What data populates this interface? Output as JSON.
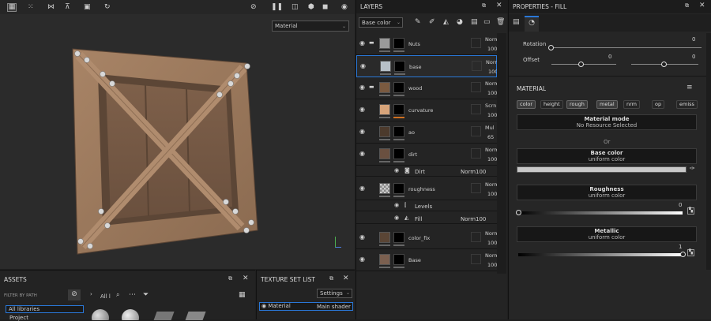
{
  "viewport": {
    "material_dropdown": "Material",
    "toolbar_icons": [
      "grid-icon",
      "dotgrid-icon",
      "split-icon",
      "align-icon",
      "media-icon",
      "history-icon",
      "visibility-off-icon",
      "pause-icon",
      "frame-icon",
      "cube-icon",
      "video-icon",
      "camera-icon"
    ]
  },
  "layers": {
    "title": "LAYERS",
    "channel": "Base color",
    "rows": [
      {
        "name": "Nuts",
        "blend": "Norm",
        "opacity": "100",
        "folder": true,
        "color": "#9a9a9a"
      },
      {
        "name": "base",
        "blend": "Norm",
        "opacity": "100",
        "folder": false,
        "color": "#b7c0c8",
        "selected": true
      },
      {
        "name": "wood",
        "blend": "Norm",
        "opacity": "100",
        "folder": true,
        "color": "#7a5a40"
      },
      {
        "name": "curvature",
        "blend": "Scrn",
        "opacity": "100",
        "folder": false,
        "color": "#d7a47a"
      },
      {
        "name": "ao",
        "blend": "Mul",
        "opacity": "65",
        "folder": false,
        "color": "#4c3a2c"
      },
      {
        "name": "dirt",
        "blend": "Norm",
        "opacity": "100",
        "folder": false,
        "color": "#6a5040"
      }
    ],
    "dirt_effect": {
      "name": "Dirt",
      "blend": "Norm",
      "opacity": "100"
    },
    "roughness": {
      "name": "roughness",
      "blend": "Norm",
      "opacity": "100"
    },
    "roughness_effects": [
      {
        "name": "Levels"
      },
      {
        "name": "Fill",
        "blend": "Norm",
        "opacity": "100"
      }
    ],
    "bottom_rows": [
      {
        "name": "color_fix",
        "blend": "Norm",
        "opacity": "100",
        "color": "#5a4535"
      },
      {
        "name": "Base",
        "blend": "Norm",
        "opacity": "100",
        "color": "#7b6050"
      }
    ]
  },
  "properties": {
    "title": "PROPERTIES - FILL",
    "rotation_label": "Rotation",
    "rotation_value": "0",
    "offset_label": "Offset",
    "offset_x": "0",
    "offset_y": "0",
    "material_title": "MATERIAL",
    "channels": [
      "color",
      "height",
      "rough",
      "metal",
      "nrm",
      "op",
      "emiss"
    ],
    "material_mode_title": "Material mode",
    "material_mode_value": "No Resource Selected",
    "or_label": "Or",
    "base_color_title": "Base color",
    "base_color_sub": "uniform color",
    "base_color_swatch": "#c8c8c8",
    "roughness_title": "Roughness",
    "roughness_sub": "uniform color",
    "roughness_value": "0",
    "roughness_level": 0.0,
    "metallic_title": "Metallic",
    "metallic_sub": "uniform color",
    "metallic_value": "1",
    "metallic_level": 1.0
  },
  "assets": {
    "title": "ASSETS",
    "filter_label": "FILTER BY PATH",
    "libraries": [
      "All libraries",
      "Project"
    ],
    "path_label": "All l"
  },
  "texture_set": {
    "title": "TEXTURE SET LIST",
    "settings_label": "Settings",
    "item_name": "Material",
    "item_shader": "Main shader"
  }
}
